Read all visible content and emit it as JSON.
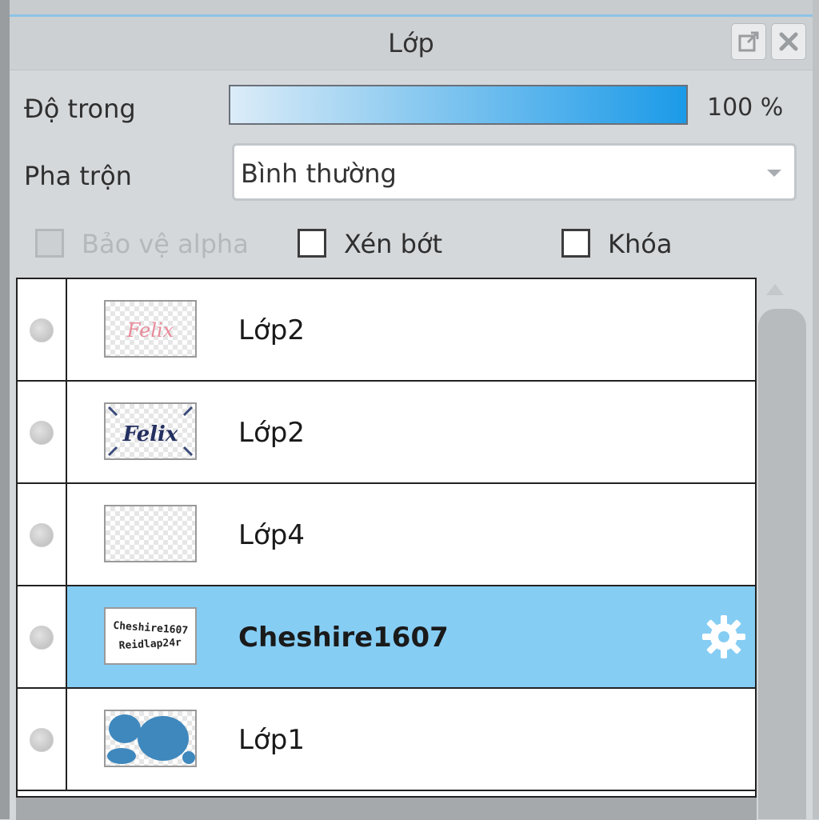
{
  "panel": {
    "title": "Lớp"
  },
  "opacity": {
    "label": "Độ trong",
    "value": "100 %"
  },
  "blend": {
    "label": "Pha trộn",
    "value": "Bình thường"
  },
  "options": {
    "protect_alpha": "Bảo vệ alpha",
    "clipping": "Xén bớt",
    "lock": "Khóa"
  },
  "layers": [
    {
      "name": "Lớp2"
    },
    {
      "name": "Lớp2"
    },
    {
      "name": "Lớp4"
    },
    {
      "name": "Cheshire1607"
    },
    {
      "name": "Lớp1"
    }
  ],
  "thumbnails": {
    "felix": "Felix",
    "cheshire_line1": "Cheshire1607",
    "cheshire_line2": "Reidlap24r"
  },
  "colors": {
    "selected_row": "#86cdf4",
    "accent": "#1b9ae8"
  }
}
